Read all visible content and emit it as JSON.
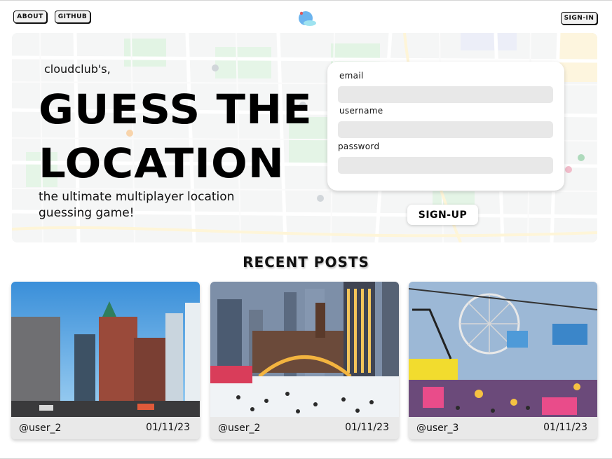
{
  "nav": {
    "about_label": "ABOUT",
    "github_label": "GITHUB",
    "signin_label": "SIGN-IN",
    "logo_icon": "globe-logo-icon"
  },
  "hero": {
    "eyebrow": "cloudclub's,",
    "headline_line1": "GUESS THE",
    "headline_line2": "LOCATION",
    "tagline": "the ultimate multiplayer location guessing game!",
    "background": "map-background"
  },
  "form": {
    "email_label": "email",
    "email_value": "",
    "username_label": "username",
    "username_value": "",
    "password_label": "password",
    "password_value": "",
    "submit_label": "SIGN-UP"
  },
  "recent": {
    "title": "RECENT POSTS",
    "posts": [
      {
        "user": "@user_2",
        "date": "01/11/23",
        "image": "city-street-photo"
      },
      {
        "user": "@user_2",
        "date": "01/11/23",
        "image": "skating-rink-photo"
      },
      {
        "user": "@user_3",
        "date": "01/11/23",
        "image": "fair-rides-photo"
      }
    ]
  },
  "colors": {
    "accent": "#000000",
    "input_bg": "#e8e8e8",
    "card_bg": "#e9e9e9",
    "logo_blue": "#5aa9e6"
  }
}
